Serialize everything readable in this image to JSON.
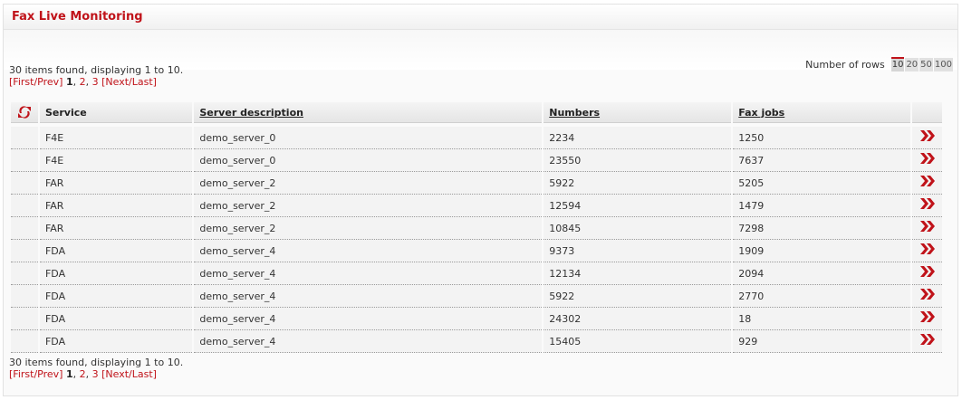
{
  "panel": {
    "title": "Fax Live Monitoring"
  },
  "summary": {
    "found_text": "30 items found, displaying 1 to 10.",
    "first_prev": "[First/Prev]",
    "current_page": "1",
    "sep1": ", ",
    "page2": "2",
    "sep2": ", ",
    "page3": "3",
    "next_last": "[Next/Last]"
  },
  "rows_control": {
    "label": "Number of rows",
    "options": [
      "10",
      "20",
      "50",
      "100"
    ],
    "selected": "10"
  },
  "table": {
    "columns": [
      "Service",
      "Server description",
      "Numbers",
      "Fax jobs"
    ],
    "rows": [
      [
        "F4E",
        "demo_server_0",
        "2234",
        "1250"
      ],
      [
        "F4E",
        "demo_server_0",
        "23550",
        "7637"
      ],
      [
        "FAR",
        "demo_server_2",
        "5922",
        "5205"
      ],
      [
        "FAR",
        "demo_server_2",
        "12594",
        "1479"
      ],
      [
        "FAR",
        "demo_server_2",
        "10845",
        "7298"
      ],
      [
        "FDA",
        "demo_server_4",
        "9373",
        "1909"
      ],
      [
        "FDA",
        "demo_server_4",
        "12134",
        "2094"
      ],
      [
        "FDA",
        "demo_server_4",
        "5922",
        "2770"
      ],
      [
        "FDA",
        "demo_server_4",
        "24302",
        "18"
      ],
      [
        "FDA",
        "demo_server_4",
        "15405",
        "929"
      ]
    ]
  },
  "icons": {
    "header": "refresh-icon",
    "row_action": "double-chevron-right-icon"
  },
  "colors": {
    "accent": "#c0131a"
  }
}
